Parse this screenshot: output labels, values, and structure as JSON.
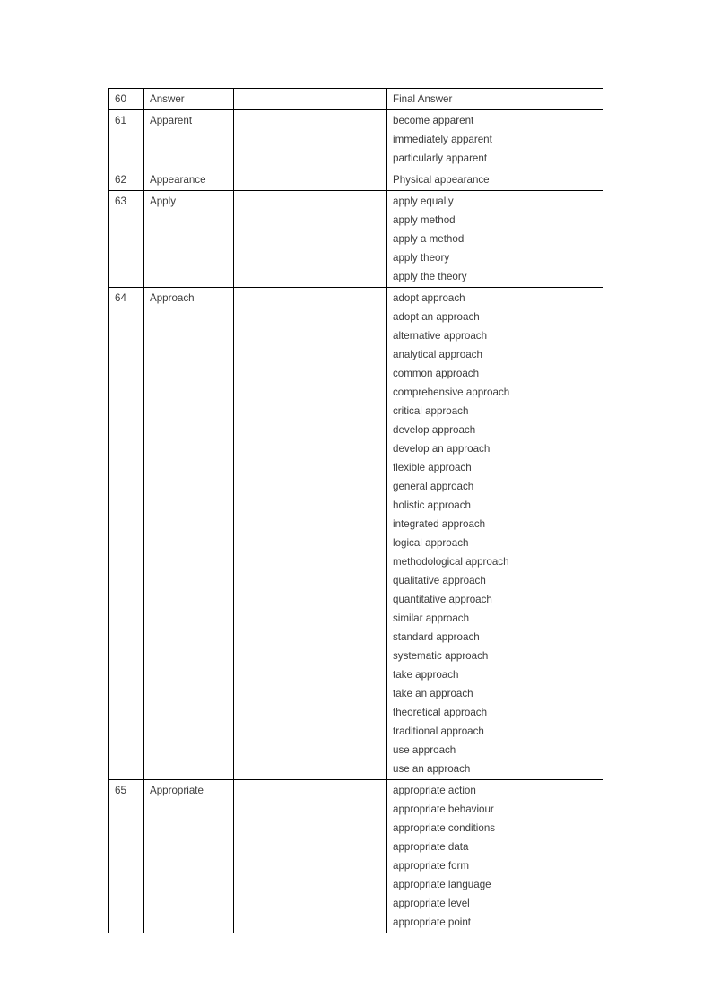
{
  "document": {
    "type": "academic-collocations-list",
    "page_background": "#ffffff",
    "table_border_color": "#000000",
    "text_color": "#3b3b3b"
  },
  "table": {
    "columns": [
      {
        "key": "number",
        "header": ""
      },
      {
        "key": "term",
        "header": ""
      },
      {
        "key": "blank",
        "header": ""
      },
      {
        "key": "collocations",
        "header": ""
      }
    ],
    "rows": [
      {
        "number": "60",
        "term": "Answer",
        "blank": "",
        "collocations": [
          "Final Answer"
        ]
      },
      {
        "number": "61",
        "term": "Apparent",
        "blank": "",
        "collocations": [
          "become apparent",
          "immediately apparent",
          "particularly apparent"
        ]
      },
      {
        "number": "62",
        "term": "Appearance",
        "blank": "",
        "collocations": [
          "Physical appearance"
        ]
      },
      {
        "number": "63",
        "term": "Apply",
        "blank": "",
        "collocations": [
          "apply equally",
          "apply method",
          "apply a method",
          "apply theory",
          "apply the theory"
        ]
      },
      {
        "number": "64",
        "term": "Approach",
        "blank": "",
        "collocations": [
          "adopt approach",
          "adopt an approach",
          "alternative approach",
          "analytical approach",
          "common approach",
          "comprehensive approach",
          "critical approach",
          "develop approach",
          "develop an approach",
          "flexible approach",
          "general approach",
          "holistic approach",
          "integrated approach",
          "logical approach",
          "methodological approach",
          "qualitative approach",
          "quantitative approach",
          "similar approach",
          "standard approach",
          "systematic approach",
          "take approach",
          "take an approach",
          "theoretical approach",
          "traditional approach",
          "use approach",
          "use an approach"
        ]
      },
      {
        "number": "65",
        "term": "Appropriate",
        "blank": "",
        "collocations": [
          "appropriate action",
          "appropriate behaviour",
          "appropriate conditions",
          "appropriate data",
          "appropriate form",
          "appropriate language",
          "appropriate level",
          "appropriate point"
        ]
      }
    ]
  }
}
